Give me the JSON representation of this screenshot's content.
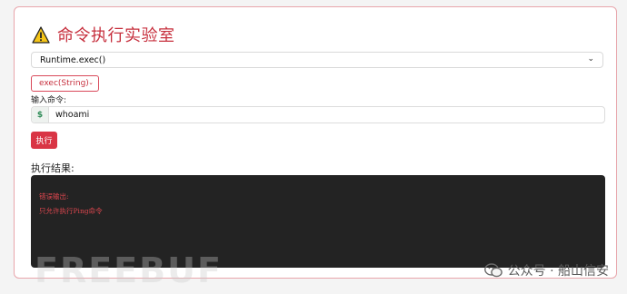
{
  "header": {
    "title": "命令执行实验室",
    "icon": "warning-icon"
  },
  "form": {
    "method_select": {
      "selected": "Runtime.exec()"
    },
    "variant_select": {
      "selected": "exec(String)"
    },
    "command_label": "输入命令:",
    "command_prefix": "$",
    "command_value": "whoami",
    "execute_label": "执行"
  },
  "result": {
    "label": "执行结果:",
    "lines": [
      "错误输出:",
      "只允许执行Ping命令"
    ]
  },
  "watermarks": {
    "freebuf": "FREEBUF",
    "wechat": "公众号 · 船山信安"
  },
  "colors": {
    "accent": "#d93545",
    "output_bg": "#232323",
    "output_text": "#e0474f"
  }
}
